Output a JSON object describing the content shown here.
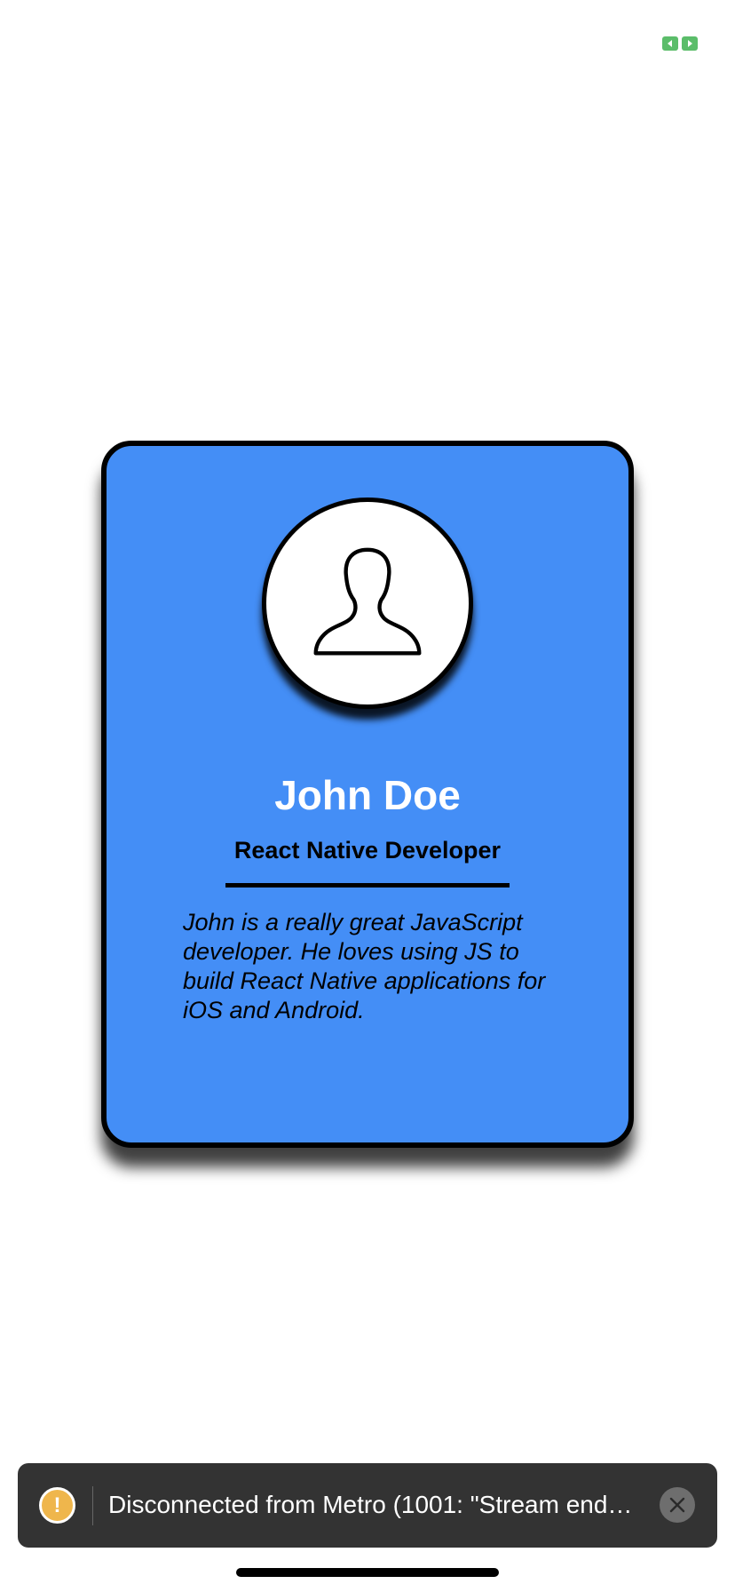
{
  "card": {
    "name": "John Doe",
    "role": "React Native Developer",
    "bio": "John is a really great JavaScript developer. He loves using JS to build React Native applications for iOS and Android.",
    "background_color": "#448ef6",
    "avatar_icon": "user-silhouette-icon"
  },
  "toast": {
    "icon": "warning-icon",
    "icon_glyph": "!",
    "message": "Disconnected from Metro (1001: \"Stream end…",
    "close_icon": "close-icon",
    "accent_color": "#efb64c"
  },
  "dev_indicator": {
    "icon": "expand-icon",
    "color": "#5bbd6a"
  }
}
